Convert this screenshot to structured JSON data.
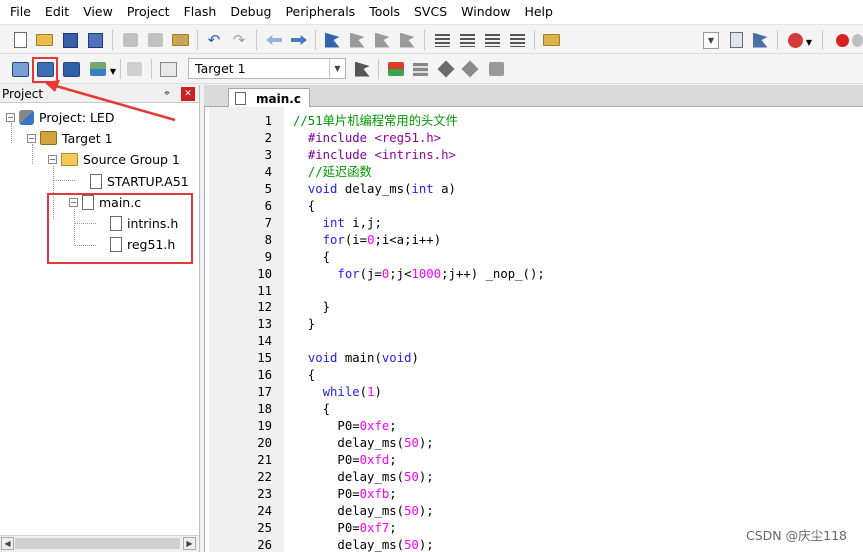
{
  "menu": [
    "File",
    "Edit",
    "View",
    "Project",
    "Flash",
    "Debug",
    "Peripherals",
    "Tools",
    "SVCS",
    "Window",
    "Help"
  ],
  "toolbar2": {
    "target": "Target 1"
  },
  "project_panel": {
    "title": "Project",
    "pin": "⌖",
    "close": "✕",
    "tree": [
      {
        "label": "Project: LED"
      },
      {
        "label": "Target 1"
      },
      {
        "label": "Source Group 1"
      },
      {
        "label": "STARTUP.A51"
      },
      {
        "label": "main.c"
      },
      {
        "label": "intrins.h"
      },
      {
        "label": "reg51.h"
      }
    ]
  },
  "editor": {
    "tab": "main.c",
    "lines": [
      {
        "n": "1",
        "t": "//51单片机编程常用的头文件"
      },
      {
        "n": "2",
        "t": "  #include <reg51.h>"
      },
      {
        "n": "3",
        "t": "  #include <intrins.h>"
      },
      {
        "n": "4",
        "t": "  //延迟函数"
      },
      {
        "n": "5",
        "t": "  void delay_ms(int a)"
      },
      {
        "n": "6",
        "t": "  {"
      },
      {
        "n": "7",
        "t": "    int i,j;"
      },
      {
        "n": "8",
        "t": "    for(i=0;i<a;i++)"
      },
      {
        "n": "9",
        "t": "    {"
      },
      {
        "n": "10",
        "t": "      for(j=0;j<1000;j++) _nop_();"
      },
      {
        "n": "11",
        "t": ""
      },
      {
        "n": "12",
        "t": "    }"
      },
      {
        "n": "13",
        "t": "  }"
      },
      {
        "n": "14",
        "t": ""
      },
      {
        "n": "15",
        "t": "  void main(void)"
      },
      {
        "n": "16",
        "t": "  {"
      },
      {
        "n": "17",
        "t": "    while(1)"
      },
      {
        "n": "18",
        "t": "    {"
      },
      {
        "n": "19",
        "t": "      P0=0xfe;"
      },
      {
        "n": "20",
        "t": "      delay_ms(50);"
      },
      {
        "n": "21",
        "t": "      P0=0xfd;"
      },
      {
        "n": "22",
        "t": "      delay_ms(50);"
      },
      {
        "n": "23",
        "t": "      P0=0xfb;"
      },
      {
        "n": "24",
        "t": "      delay_ms(50);"
      },
      {
        "n": "25",
        "t": "      P0=0xf7;"
      },
      {
        "n": "26",
        "t": "      delay_ms(50);"
      }
    ]
  },
  "watermark": "CSDN @庆尘118",
  "colors": {
    "highlight": "#e53935",
    "keyword": "#1e1eff",
    "comment": "#009900",
    "number": "#ff00ff"
  }
}
